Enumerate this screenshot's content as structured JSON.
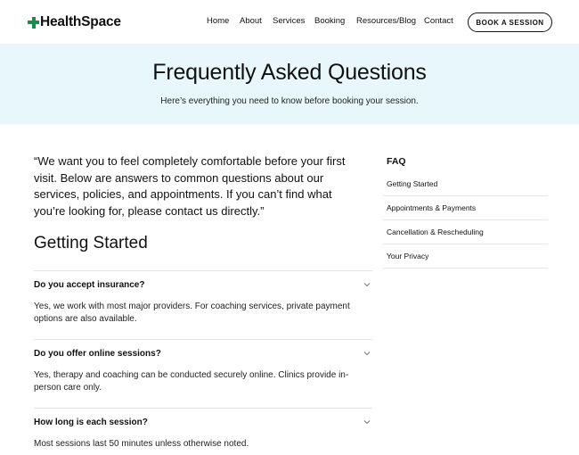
{
  "header": {
    "logo": {
      "mark": "plus-icon",
      "text": "HealthSpace",
      "mark_color": "#1f8a4c"
    },
    "nav": [
      "Home",
      "About",
      "Services",
      "Booking",
      "Resources/Blog",
      "Contact"
    ],
    "cta_label": "BOOK A SESSION"
  },
  "hero": {
    "title": "Frequently Asked Questions",
    "subtitle": "Here’s everything you need to know before booking your session.",
    "background": "#e8f7fc"
  },
  "intro_quote": "“We want you to feel completely comfortable before your first visit. Below are answers to common questions about our services, policies, and appointments. If you can’t find what you’re looking for, please contact us directly.”",
  "section_title": "Getting Started",
  "faqs": [
    {
      "question": "Do you accept insurance?",
      "answer": "Yes, we work with most major providers. For coaching services, private payment options are also available.",
      "icon": "chevron-down-icon"
    },
    {
      "question": "Do you offer online sessions?",
      "answer": "Yes, therapy and coaching can be conducted securely online. Clinics provide in-person care only.",
      "icon": "chevron-down-icon"
    },
    {
      "question": "How long is each session?",
      "answer": "Most sessions last 50 minutes unless otherwise noted.",
      "icon": "chevron-down-icon"
    }
  ],
  "sidebar": {
    "title": "FAQ",
    "items": [
      "Getting Started",
      "Appointments & Payments",
      "Cancellation & Rescheduling",
      "Your Privacy"
    ]
  }
}
